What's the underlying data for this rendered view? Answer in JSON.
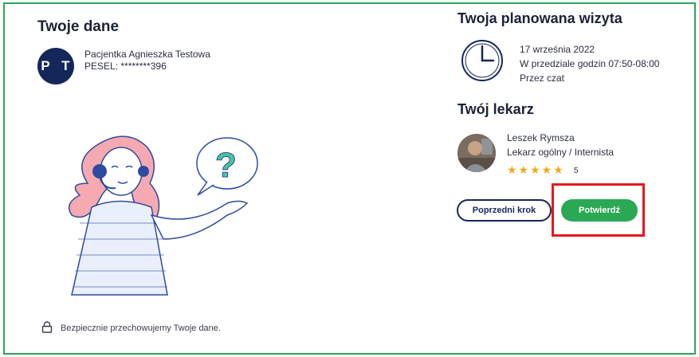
{
  "patient_section": {
    "title": "Twoje dane",
    "avatar_initials": "P T",
    "name": "Pacjentka Agnieszka Testowa",
    "pesel": "PESEL: ********396"
  },
  "visit_section": {
    "title": "Twoja planowana wizyta",
    "date": "17 września 2022",
    "hours": "W przedziale godzin 07:50-08:00",
    "channel": "Przez czat",
    "icon": "clock-icon"
  },
  "doctor_section": {
    "title": "Twój lekarz",
    "name": "Leszek Rymsza",
    "specialty": "Lekarz ogólny / Internista",
    "stars": "★★★★★",
    "rating": "5"
  },
  "actions": {
    "prev_label": "Poprzedni krok",
    "confirm_label": "Potwierdź"
  },
  "footer": {
    "note": "Bezpiecznie przechowujemy Twoje dane.",
    "icon": "lock-icon"
  },
  "colors": {
    "accent_green": "#2aa854",
    "navy": "#15275a",
    "highlight_red": "#e8161b"
  }
}
